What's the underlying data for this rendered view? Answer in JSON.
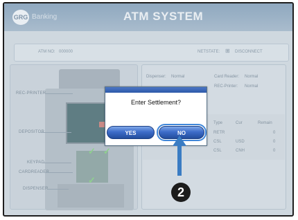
{
  "header": {
    "logo_text": "GRG",
    "brand_text": "Banking",
    "app_title": "ATM SYSTEM"
  },
  "status_bar": {
    "atm_no_label": "ATM NO:",
    "atm_no_value": "000000",
    "netstate_label": "NETSTATE:",
    "netstate_value": "DISCONNECT"
  },
  "components": {
    "rec_printer": "REC-PRINTER",
    "depositor": "DEPOSITOR",
    "keypad": "KEYPAD",
    "cardreader": "CARDREADER",
    "dispenser": "DISPENSER"
  },
  "device_status": {
    "dispenser_label": "Dispenser:",
    "dispenser_value": "Normal",
    "card_reader_label": "Card Reader:",
    "card_reader_value": "Normal",
    "rec_printer_label": "REC-Printer:",
    "rec_printer_value": "Normal"
  },
  "cassette_table": {
    "headers": [
      "Type",
      "Cur",
      "Remain"
    ],
    "rows": [
      {
        "type": "RETR",
        "cur": "",
        "remain": "0"
      },
      {
        "type": "CSL",
        "cur": "USD",
        "remain": "0"
      },
      {
        "type": "CSL",
        "cur": "CNH",
        "remain": "0"
      }
    ]
  },
  "dialog": {
    "prompt": "Enter Settlement?",
    "yes_label": "YES",
    "no_label": "NO"
  },
  "callout": {
    "number": "2"
  },
  "colors": {
    "arrow": "#3a7cc3",
    "button": "#2f5fb8",
    "callout": "#1c1c1c"
  }
}
